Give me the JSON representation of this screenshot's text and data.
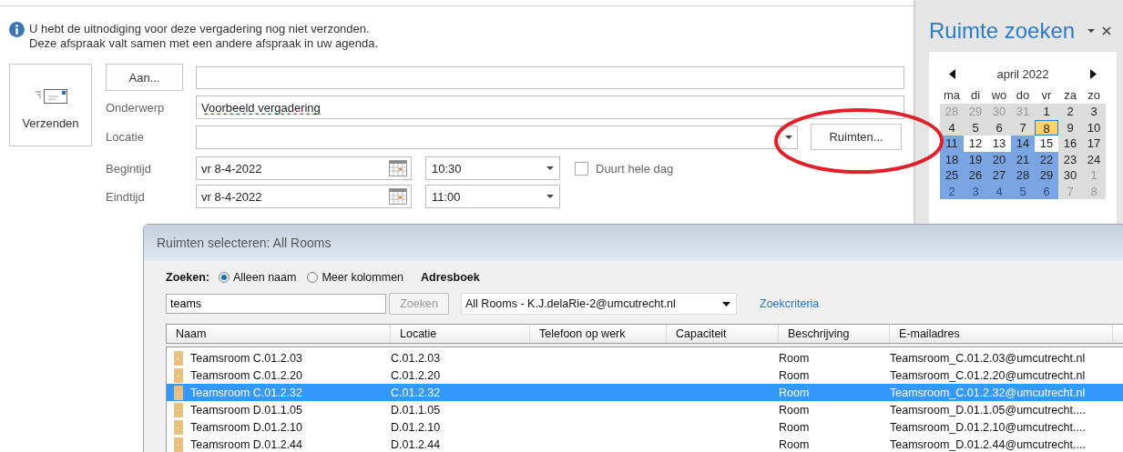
{
  "info": {
    "lines": [
      "U hebt de uitnodiging voor deze vergadering nog niet verzonden.",
      "Deze afspraak valt samen met een andere afspraak in uw agenda."
    ]
  },
  "send_button": {
    "label": "Verzenden"
  },
  "form": {
    "to_button": "Aan...",
    "subject_label": "Onderwerp",
    "subject": "Voorbeeld vergadering",
    "location_label": "Locatie",
    "rooms_button": "Ruimten...",
    "start_label": "Begintijd",
    "start_date": "vr 8-4-2022",
    "start_time": "10:30",
    "end_label": "Eindtijd",
    "end_date": "vr 8-4-2022",
    "end_time": "11:00",
    "all_day": {
      "label": "Duurt hele dag",
      "checked": false
    }
  },
  "room_finder": {
    "title": "Ruimte zoeken",
    "month": "april 2022",
    "weekdays": [
      "ma",
      "di",
      "wo",
      "do",
      "vr",
      "za",
      "zo"
    ],
    "weeks": [
      [
        {
          "day": "28",
          "muted": true,
          "color": "#dcdcdc",
          "selected": false
        },
        {
          "day": "29",
          "muted": true,
          "color": "#dcdcdc",
          "selected": false
        },
        {
          "day": "30",
          "muted": true,
          "color": "#dcdcdc",
          "selected": false
        },
        {
          "day": "31",
          "muted": true,
          "color": "#dcdcdc",
          "selected": false
        },
        {
          "day": "1",
          "muted": false,
          "color": "#dcdcdc",
          "selected": false
        },
        {
          "day": "2",
          "muted": false,
          "color": "#dcdcdc",
          "selected": false
        },
        {
          "day": "3",
          "muted": false,
          "color": "#dcdcdc",
          "selected": false
        }
      ],
      [
        {
          "day": "4",
          "muted": false,
          "color": "#dcdcdc",
          "selected": false
        },
        {
          "day": "5",
          "muted": false,
          "color": "#dcdcdc",
          "selected": false
        },
        {
          "day": "6",
          "muted": false,
          "color": "#dcdcdc",
          "selected": false
        },
        {
          "day": "7",
          "muted": false,
          "color": "#dcdcdc",
          "selected": false
        },
        {
          "day": "8",
          "muted": false,
          "color": "#fdd26a",
          "selected": true
        },
        {
          "day": "9",
          "muted": false,
          "color": "#dcdcdc",
          "selected": false
        },
        {
          "day": "10",
          "muted": false,
          "color": "#dcdcdc",
          "selected": false
        }
      ],
      [
        {
          "day": "11",
          "muted": false,
          "color": "#7aa5e2",
          "selected": false
        },
        {
          "day": "12",
          "muted": false,
          "color": "#ffffff",
          "selected": false
        },
        {
          "day": "13",
          "muted": false,
          "color": "#ffffff",
          "selected": false
        },
        {
          "day": "14",
          "muted": false,
          "color": "#7aa5e2",
          "selected": false
        },
        {
          "day": "15",
          "muted": false,
          "color": "#ffffff",
          "selected": false
        },
        {
          "day": "16",
          "muted": false,
          "color": "#dcdcdc",
          "selected": false
        },
        {
          "day": "17",
          "muted": false,
          "color": "#dcdcdc",
          "selected": false
        }
      ],
      [
        {
          "day": "18",
          "muted": false,
          "color": "#7aa5e2",
          "selected": false
        },
        {
          "day": "19",
          "muted": false,
          "color": "#7aa5e2",
          "selected": false
        },
        {
          "day": "20",
          "muted": false,
          "color": "#7aa5e2",
          "selected": false
        },
        {
          "day": "21",
          "muted": false,
          "color": "#7aa5e2",
          "selected": false
        },
        {
          "day": "22",
          "muted": false,
          "color": "#7aa5e2",
          "selected": false
        },
        {
          "day": "23",
          "muted": false,
          "color": "#dcdcdc",
          "selected": false
        },
        {
          "day": "24",
          "muted": false,
          "color": "#dcdcdc",
          "selected": false
        }
      ],
      [
        {
          "day": "25",
          "muted": false,
          "color": "#7aa5e2",
          "selected": false
        },
        {
          "day": "26",
          "muted": false,
          "color": "#7aa5e2",
          "selected": false
        },
        {
          "day": "27",
          "muted": false,
          "color": "#7aa5e2",
          "selected": false
        },
        {
          "day": "28",
          "muted": false,
          "color": "#7aa5e2",
          "selected": false
        },
        {
          "day": "29",
          "muted": false,
          "color": "#7aa5e2",
          "selected": false
        },
        {
          "day": "30",
          "muted": false,
          "color": "#dcdcdc",
          "selected": false
        },
        {
          "day": "1",
          "muted": true,
          "color": "#dcdcdc",
          "selected": false
        }
      ],
      [
        {
          "day": "2",
          "muted": true,
          "color": "#7aa5e2",
          "selected": false
        },
        {
          "day": "3",
          "muted": true,
          "color": "#7aa5e2",
          "selected": false
        },
        {
          "day": "4",
          "muted": true,
          "color": "#7aa5e2",
          "selected": false
        },
        {
          "day": "5",
          "muted": true,
          "color": "#7aa5e2",
          "selected": false
        },
        {
          "day": "6",
          "muted": true,
          "color": "#7aa5e2",
          "selected": false
        },
        {
          "day": "7",
          "muted": true,
          "color": "#dcdcdc",
          "selected": false
        },
        {
          "day": "8",
          "muted": true,
          "color": "#dcdcdc",
          "selected": false
        }
      ]
    ]
  },
  "dialog": {
    "title": "Ruimten selecteren: All Rooms",
    "search_label": "Zoeken:",
    "search_modes": [
      {
        "label": "Alleen naam",
        "selected": true
      },
      {
        "label": "Meer kolommen",
        "selected": false
      }
    ],
    "addressbook_label": "Adresboek",
    "search": {
      "value": "teams"
    },
    "search_button": {
      "label": "Zoeken",
      "disabled": true
    },
    "addressbook": "All Rooms - K.J.delaRie-2@umcutrecht.nl",
    "criteria_link": "Zoekcriteria",
    "columns": [
      "Naam",
      "Locatie",
      "Telefoon op werk",
      "Capaciteit",
      "Beschrijving",
      "E-mailadres"
    ],
    "rows": [
      {
        "name": "Teamsroom C.01.2.03",
        "location": "C.01.2.03",
        "description": "Room",
        "email": "Teamsroom_C.01.2.03@umcutrecht.nl",
        "selected": false
      },
      {
        "name": "Teamsroom C.01.2.20",
        "location": "C.01.2.20",
        "description": "Room",
        "email": "Teamsroom_C.01.2.20@umcutrecht.nl",
        "selected": false
      },
      {
        "name": "Teamsroom C.01.2.32",
        "location": "C.01.2.32",
        "description": "Room",
        "email": "Teamsroom_C.01.2.32@umcutrecht.nl",
        "selected": true
      },
      {
        "name": "Teamsroom D.01.1.05",
        "location": "D.01.1.05",
        "description": "Room",
        "email": "Teamsroom_D.01.1.05@umcutrecht....",
        "selected": false
      },
      {
        "name": "Teamsroom D.01.2.10",
        "location": "D.01.2.10",
        "description": "Room",
        "email": "Teamsroom_D.01.2.10@umcutrecht....",
        "selected": false
      },
      {
        "name": "Teamsroom D.01.2.44",
        "location": "D.01.2.44",
        "description": "Room",
        "email": "Teamsroom_D.01.2.44@umcutrecht....",
        "selected": false
      }
    ]
  }
}
